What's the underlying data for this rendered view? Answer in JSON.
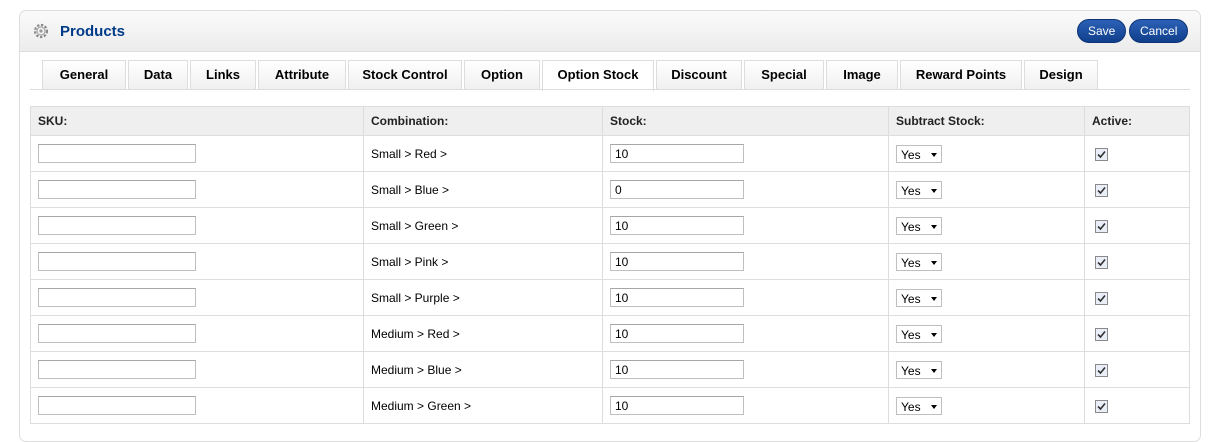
{
  "header": {
    "title": "Products",
    "save_label": "Save",
    "cancel_label": "Cancel"
  },
  "tabs": [
    {
      "label": "General"
    },
    {
      "label": "Data"
    },
    {
      "label": "Links"
    },
    {
      "label": "Attribute"
    },
    {
      "label": "Stock Control"
    },
    {
      "label": "Option"
    },
    {
      "label": "Option Stock",
      "active": true
    },
    {
      "label": "Discount"
    },
    {
      "label": "Special"
    },
    {
      "label": "Image"
    },
    {
      "label": "Reward Points"
    },
    {
      "label": "Design"
    }
  ],
  "table": {
    "headers": {
      "sku": "SKU:",
      "combination": "Combination:",
      "stock": "Stock:",
      "subtract": "Subtract Stock:",
      "active": "Active:"
    },
    "rows": [
      {
        "sku": "",
        "combination": "Small > Red >",
        "stock": "10",
        "subtract": "Yes",
        "active": true
      },
      {
        "sku": "",
        "combination": "Small > Blue >",
        "stock": "0",
        "subtract": "Yes",
        "active": true
      },
      {
        "sku": "",
        "combination": "Small > Green >",
        "stock": "10",
        "subtract": "Yes",
        "active": true
      },
      {
        "sku": "",
        "combination": "Small > Pink >",
        "stock": "10",
        "subtract": "Yes",
        "active": true
      },
      {
        "sku": "",
        "combination": "Small > Purple >",
        "stock": "10",
        "subtract": "Yes",
        "active": true
      },
      {
        "sku": "",
        "combination": "Medium > Red >",
        "stock": "10",
        "subtract": "Yes",
        "active": true
      },
      {
        "sku": "",
        "combination": "Medium > Blue >",
        "stock": "10",
        "subtract": "Yes",
        "active": true
      },
      {
        "sku": "",
        "combination": "Medium > Green >",
        "stock": "10",
        "subtract": "Yes",
        "active": true
      }
    ]
  }
}
